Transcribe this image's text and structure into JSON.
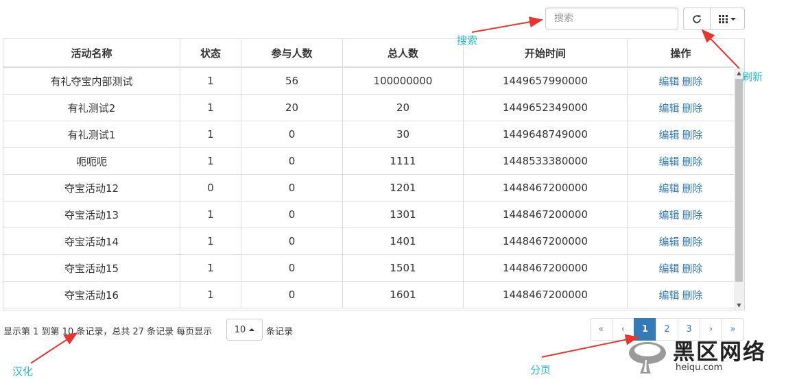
{
  "toolbar": {
    "search_placeholder": "搜索",
    "refresh_icon": "refresh-icon",
    "columns_icon": "grid-icon"
  },
  "table": {
    "headers": [
      "活动名称",
      "状态",
      "参与人数",
      "总人数",
      "开始时间",
      "操作"
    ],
    "edit_label": "编辑",
    "delete_label": "删除",
    "rows": [
      {
        "name": "有礼夺宝内部测试",
        "status": "1",
        "participants": "56",
        "total": "100000000",
        "start": "1449657990000"
      },
      {
        "name": "有礼测试2",
        "status": "1",
        "participants": "20",
        "total": "20",
        "start": "1449652349000"
      },
      {
        "name": "有礼测试1",
        "status": "1",
        "participants": "0",
        "total": "30",
        "start": "1449648749000"
      },
      {
        "name": "呃呃呃",
        "status": "1",
        "participants": "0",
        "total": "1111",
        "start": "1448533380000"
      },
      {
        "name": "夺宝活动12",
        "status": "0",
        "participants": "0",
        "total": "1201",
        "start": "1448467200000"
      },
      {
        "name": "夺宝活动13",
        "status": "1",
        "participants": "0",
        "total": "1301",
        "start": "1448467200000"
      },
      {
        "name": "夺宝活动14",
        "status": "1",
        "participants": "0",
        "total": "1401",
        "start": "1448467200000"
      },
      {
        "name": "夺宝活动15",
        "status": "1",
        "participants": "0",
        "total": "1501",
        "start": "1448467200000"
      },
      {
        "name": "夺宝活动16",
        "status": "1",
        "participants": "0",
        "total": "1601",
        "start": "1448467200000"
      }
    ]
  },
  "footer": {
    "info": "显示第 1 到第 10 条记录，总共 27 条记录 每页显示",
    "page_size": "10",
    "records_label": "条记录",
    "pages": [
      "«",
      "‹",
      "1",
      "2",
      "3",
      "›",
      "»"
    ],
    "active_page": "1"
  },
  "annotations": {
    "search": "搜索",
    "refresh": "刷新",
    "localize": "汉化",
    "paging": "分页"
  },
  "watermark": {
    "brand_cn": "黑区网络",
    "domain": "heiqu.com"
  },
  "colors": {
    "link": "#337ab7",
    "annotation_text": "#26b9c9",
    "arrow": "#e8362f"
  }
}
